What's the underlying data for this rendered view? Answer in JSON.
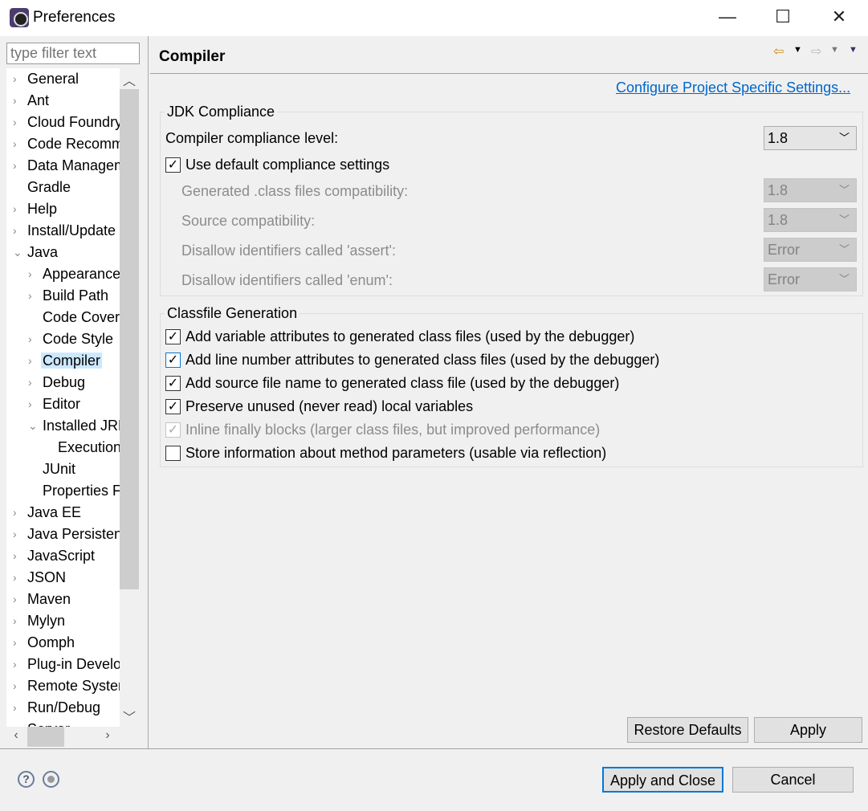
{
  "window": {
    "title": "Preferences",
    "minimize": "—",
    "maximize": "☐",
    "close": "✕"
  },
  "filter": {
    "placeholder": "type filter text"
  },
  "tree": [
    {
      "label": "General",
      "level": 0,
      "chevron": "›"
    },
    {
      "label": "Ant",
      "level": 0,
      "chevron": "›"
    },
    {
      "label": "Cloud Foundry",
      "level": 0,
      "chevron": "›"
    },
    {
      "label": "Code Recommenders",
      "level": 0,
      "chevron": "›"
    },
    {
      "label": "Data Management",
      "level": 0,
      "chevron": "›"
    },
    {
      "label": "Gradle",
      "level": 0,
      "chevron": ""
    },
    {
      "label": "Help",
      "level": 0,
      "chevron": "›"
    },
    {
      "label": "Install/Update",
      "level": 0,
      "chevron": "›"
    },
    {
      "label": "Java",
      "level": 0,
      "chevron": "⌄"
    },
    {
      "label": "Appearance",
      "level": 1,
      "chevron": "›"
    },
    {
      "label": "Build Path",
      "level": 1,
      "chevron": "›"
    },
    {
      "label": "Code Coverage",
      "level": 1,
      "chevron": ""
    },
    {
      "label": "Code Style",
      "level": 1,
      "chevron": "›"
    },
    {
      "label": "Compiler",
      "level": 1,
      "chevron": "›",
      "selected": true
    },
    {
      "label": "Debug",
      "level": 1,
      "chevron": "›"
    },
    {
      "label": "Editor",
      "level": 1,
      "chevron": "›"
    },
    {
      "label": "Installed JREs",
      "level": 1,
      "chevron": "⌄"
    },
    {
      "label": "Execution Environments",
      "level": 2,
      "chevron": ""
    },
    {
      "label": "JUnit",
      "level": 1,
      "chevron": ""
    },
    {
      "label": "Properties Files Editor",
      "level": 1,
      "chevron": ""
    },
    {
      "label": "Java EE",
      "level": 0,
      "chevron": "›"
    },
    {
      "label": "Java Persistence",
      "level": 0,
      "chevron": "›"
    },
    {
      "label": "JavaScript",
      "level": 0,
      "chevron": "›"
    },
    {
      "label": "JSON",
      "level": 0,
      "chevron": "›"
    },
    {
      "label": "Maven",
      "level": 0,
      "chevron": "›"
    },
    {
      "label": "Mylyn",
      "level": 0,
      "chevron": "›"
    },
    {
      "label": "Oomph",
      "level": 0,
      "chevron": "›"
    },
    {
      "label": "Plug-in Development",
      "level": 0,
      "chevron": "›"
    },
    {
      "label": "Remote Systems",
      "level": 0,
      "chevron": "›"
    },
    {
      "label": "Run/Debug",
      "level": 0,
      "chevron": "›"
    },
    {
      "label": "Server",
      "level": 0,
      "chevron": "›"
    }
  ],
  "page": {
    "title": "Compiler",
    "link": "Configure Project Specific Settings...",
    "jdk": {
      "title": "JDK Compliance",
      "compliance_label": "Compiler compliance level:",
      "compliance_value": "1.8",
      "use_default_label": "Use default compliance settings",
      "use_default_checked": true,
      "rows": [
        {
          "label": "Generated .class files compatibility:",
          "value": "1.8"
        },
        {
          "label": "Source compatibility:",
          "value": "1.8"
        },
        {
          "label": "Disallow identifiers called 'assert':",
          "value": "Error"
        },
        {
          "label": "Disallow identifiers called 'enum':",
          "value": "Error"
        }
      ]
    },
    "classfile": {
      "title": "Classfile Generation",
      "options": [
        {
          "label": "Add variable attributes to generated class files (used by the debugger)",
          "checked": true
        },
        {
          "label": "Add line number attributes to generated class files (used by the debugger)",
          "checked": true
        },
        {
          "label": "Add source file name to generated class file (used by the debugger)",
          "checked": true
        },
        {
          "label": "Preserve unused (never read) local variables",
          "checked": true
        },
        {
          "label": "Inline finally blocks (larger class files, but improved performance)",
          "checked": true,
          "disabled": true
        },
        {
          "label": "Store information about method parameters (usable via reflection)",
          "checked": false
        }
      ]
    },
    "restore": "Restore Defaults",
    "apply": "Apply"
  },
  "footer": {
    "apply_close": "Apply and Close",
    "cancel": "Cancel",
    "help": "?"
  }
}
